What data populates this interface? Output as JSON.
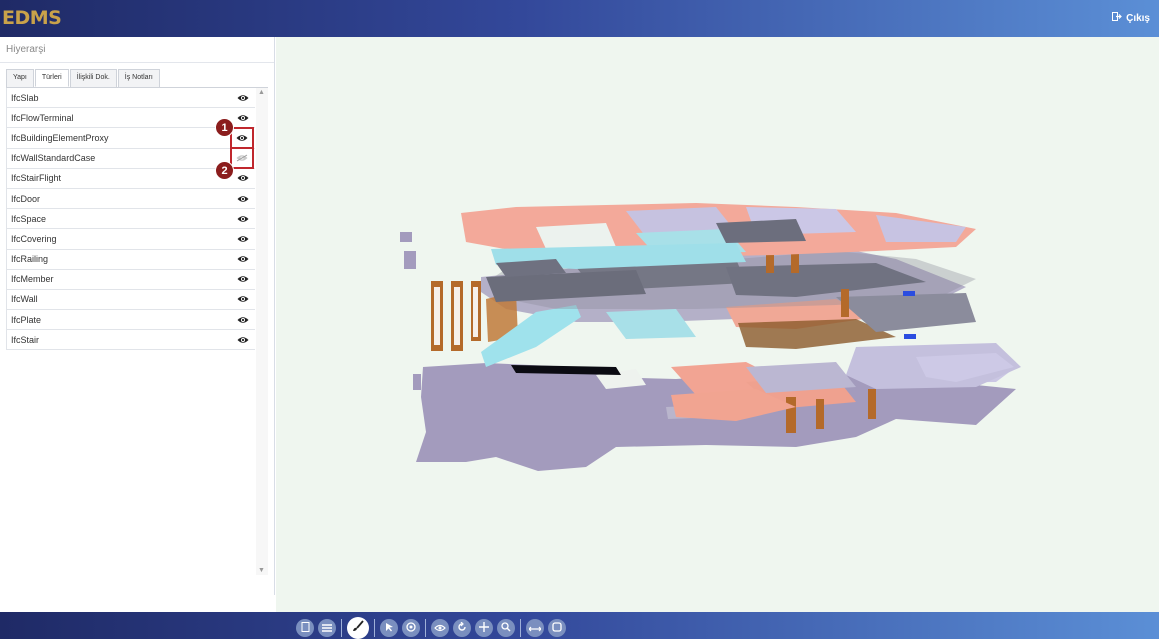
{
  "header": {
    "logo": "EDMS",
    "logout_label": "Çıkış"
  },
  "panel": {
    "title": "Hiyerarşi",
    "tabs": [
      {
        "label": "Yapı",
        "active": false
      },
      {
        "label": "Türleri",
        "active": true
      },
      {
        "label": "İlişkili Dok.",
        "active": false
      },
      {
        "label": "İş Notları",
        "active": false
      }
    ],
    "items": [
      {
        "label": "IfcSlab",
        "visible": true
      },
      {
        "label": "IfcFlowTerminal",
        "visible": true
      },
      {
        "label": "IfcBuildingElementProxy",
        "visible": true
      },
      {
        "label": "IfcWallStandardCase",
        "visible": false
      },
      {
        "label": "IfcStairFlight",
        "visible": true
      },
      {
        "label": "IfcDoor",
        "visible": true
      },
      {
        "label": "IfcSpace",
        "visible": true
      },
      {
        "label": "IfcCovering",
        "visible": true
      },
      {
        "label": "IfcRailing",
        "visible": true
      },
      {
        "label": "IfcMember",
        "visible": true
      },
      {
        "label": "IfcWall",
        "visible": true
      },
      {
        "label": "IfcPlate",
        "visible": true
      },
      {
        "label": "IfcStair",
        "visible": true
      }
    ],
    "annotations": [
      {
        "label": "1"
      },
      {
        "label": "2"
      }
    ]
  },
  "toolbar": {
    "buttons": [
      "bookmark-icon",
      "list-icon",
      "brush-icon",
      "pointer-icon",
      "target-icon",
      "eye-icon",
      "rotate-icon",
      "pan-icon",
      "zoom-icon",
      "measure-icon",
      "fit-icon"
    ]
  }
}
